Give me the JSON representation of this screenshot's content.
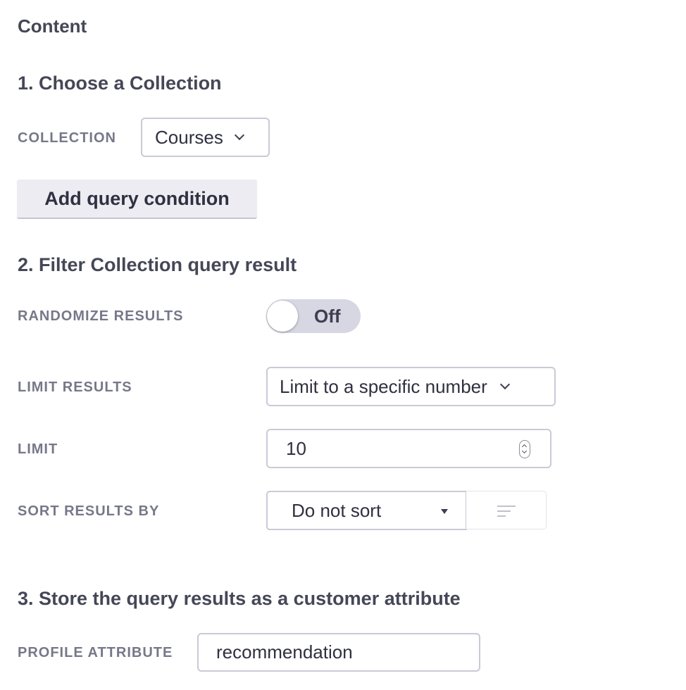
{
  "page": {
    "title": "Content"
  },
  "section1": {
    "title": "1. Choose a Collection",
    "collection_label": "COLLECTION",
    "collection_value": "Courses",
    "add_condition_label": "Add query condition"
  },
  "section2": {
    "title": "2. Filter Collection query result",
    "randomize_label": "RANDOMIZE RESULTS",
    "randomize_state": "Off",
    "limit_results_label": "LIMIT RESULTS",
    "limit_results_value": "Limit to a specific number",
    "limit_label": "LIMIT",
    "limit_value": "10",
    "sort_label": "SORT RESULTS BY",
    "sort_value": "Do not sort",
    "sort_order_icon": "sort-order-icon"
  },
  "section3": {
    "title": "3. Store the query results as a customer attribute",
    "profile_attr_label": "PROFILE ATTRIBUTE",
    "profile_attr_value": "recommendation"
  },
  "colors": {
    "text_heading": "#454757",
    "text_label": "#767889",
    "border": "#c9cad6",
    "button_bg": "#ececf2",
    "toggle_bg": "#d6d7e2"
  }
}
